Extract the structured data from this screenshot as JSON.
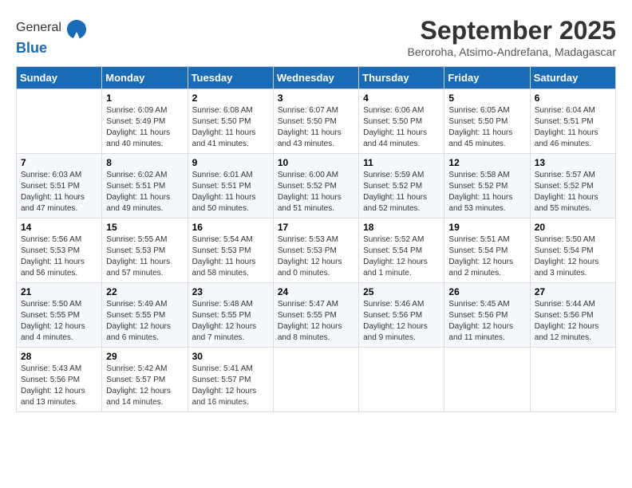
{
  "logo": {
    "general": "General",
    "blue": "Blue"
  },
  "title": "September 2025",
  "subtitle": "Beroroha, Atsimo-Andrefana, Madagascar",
  "headers": [
    "Sunday",
    "Monday",
    "Tuesday",
    "Wednesday",
    "Thursday",
    "Friday",
    "Saturday"
  ],
  "weeks": [
    [
      {
        "day": "",
        "text": ""
      },
      {
        "day": "1",
        "text": "Sunrise: 6:09 AM\nSunset: 5:49 PM\nDaylight: 11 hours\nand 40 minutes."
      },
      {
        "day": "2",
        "text": "Sunrise: 6:08 AM\nSunset: 5:50 PM\nDaylight: 11 hours\nand 41 minutes."
      },
      {
        "day": "3",
        "text": "Sunrise: 6:07 AM\nSunset: 5:50 PM\nDaylight: 11 hours\nand 43 minutes."
      },
      {
        "day": "4",
        "text": "Sunrise: 6:06 AM\nSunset: 5:50 PM\nDaylight: 11 hours\nand 44 minutes."
      },
      {
        "day": "5",
        "text": "Sunrise: 6:05 AM\nSunset: 5:50 PM\nDaylight: 11 hours\nand 45 minutes."
      },
      {
        "day": "6",
        "text": "Sunrise: 6:04 AM\nSunset: 5:51 PM\nDaylight: 11 hours\nand 46 minutes."
      }
    ],
    [
      {
        "day": "7",
        "text": "Sunrise: 6:03 AM\nSunset: 5:51 PM\nDaylight: 11 hours\nand 47 minutes."
      },
      {
        "day": "8",
        "text": "Sunrise: 6:02 AM\nSunset: 5:51 PM\nDaylight: 11 hours\nand 49 minutes."
      },
      {
        "day": "9",
        "text": "Sunrise: 6:01 AM\nSunset: 5:51 PM\nDaylight: 11 hours\nand 50 minutes."
      },
      {
        "day": "10",
        "text": "Sunrise: 6:00 AM\nSunset: 5:52 PM\nDaylight: 11 hours\nand 51 minutes."
      },
      {
        "day": "11",
        "text": "Sunrise: 5:59 AM\nSunset: 5:52 PM\nDaylight: 11 hours\nand 52 minutes."
      },
      {
        "day": "12",
        "text": "Sunrise: 5:58 AM\nSunset: 5:52 PM\nDaylight: 11 hours\nand 53 minutes."
      },
      {
        "day": "13",
        "text": "Sunrise: 5:57 AM\nSunset: 5:52 PM\nDaylight: 11 hours\nand 55 minutes."
      }
    ],
    [
      {
        "day": "14",
        "text": "Sunrise: 5:56 AM\nSunset: 5:53 PM\nDaylight: 11 hours\nand 56 minutes."
      },
      {
        "day": "15",
        "text": "Sunrise: 5:55 AM\nSunset: 5:53 PM\nDaylight: 11 hours\nand 57 minutes."
      },
      {
        "day": "16",
        "text": "Sunrise: 5:54 AM\nSunset: 5:53 PM\nDaylight: 11 hours\nand 58 minutes."
      },
      {
        "day": "17",
        "text": "Sunrise: 5:53 AM\nSunset: 5:53 PM\nDaylight: 12 hours\nand 0 minutes."
      },
      {
        "day": "18",
        "text": "Sunrise: 5:52 AM\nSunset: 5:54 PM\nDaylight: 12 hours\nand 1 minute."
      },
      {
        "day": "19",
        "text": "Sunrise: 5:51 AM\nSunset: 5:54 PM\nDaylight: 12 hours\nand 2 minutes."
      },
      {
        "day": "20",
        "text": "Sunrise: 5:50 AM\nSunset: 5:54 PM\nDaylight: 12 hours\nand 3 minutes."
      }
    ],
    [
      {
        "day": "21",
        "text": "Sunrise: 5:50 AM\nSunset: 5:55 PM\nDaylight: 12 hours\nand 4 minutes."
      },
      {
        "day": "22",
        "text": "Sunrise: 5:49 AM\nSunset: 5:55 PM\nDaylight: 12 hours\nand 6 minutes."
      },
      {
        "day": "23",
        "text": "Sunrise: 5:48 AM\nSunset: 5:55 PM\nDaylight: 12 hours\nand 7 minutes."
      },
      {
        "day": "24",
        "text": "Sunrise: 5:47 AM\nSunset: 5:55 PM\nDaylight: 12 hours\nand 8 minutes."
      },
      {
        "day": "25",
        "text": "Sunrise: 5:46 AM\nSunset: 5:56 PM\nDaylight: 12 hours\nand 9 minutes."
      },
      {
        "day": "26",
        "text": "Sunrise: 5:45 AM\nSunset: 5:56 PM\nDaylight: 12 hours\nand 11 minutes."
      },
      {
        "day": "27",
        "text": "Sunrise: 5:44 AM\nSunset: 5:56 PM\nDaylight: 12 hours\nand 12 minutes."
      }
    ],
    [
      {
        "day": "28",
        "text": "Sunrise: 5:43 AM\nSunset: 5:56 PM\nDaylight: 12 hours\nand 13 minutes."
      },
      {
        "day": "29",
        "text": "Sunrise: 5:42 AM\nSunset: 5:57 PM\nDaylight: 12 hours\nand 14 minutes."
      },
      {
        "day": "30",
        "text": "Sunrise: 5:41 AM\nSunset: 5:57 PM\nDaylight: 12 hours\nand 16 minutes."
      },
      {
        "day": "",
        "text": ""
      },
      {
        "day": "",
        "text": ""
      },
      {
        "day": "",
        "text": ""
      },
      {
        "day": "",
        "text": ""
      }
    ]
  ]
}
